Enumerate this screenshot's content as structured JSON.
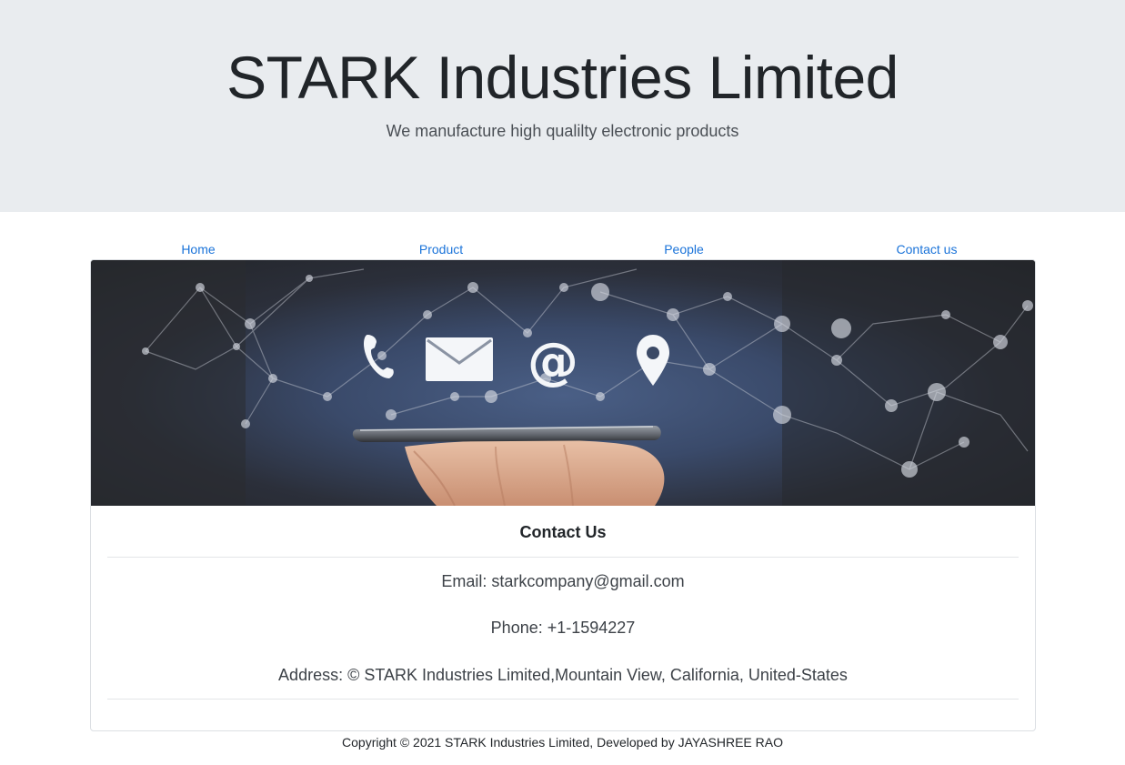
{
  "header": {
    "title": "STARK Industries Limited",
    "tagline": "We manufacture high qualilty electronic products"
  },
  "nav": {
    "items": [
      {
        "label": "Home"
      },
      {
        "label": "Product"
      },
      {
        "label": "People"
      },
      {
        "label": "Contact us"
      }
    ]
  },
  "hero": {
    "icons": [
      "phone-icon",
      "envelope-icon",
      "at-sign-icon",
      "location-pin-icon"
    ],
    "subject": "hand holding smartphone with network lines"
  },
  "contact": {
    "heading": "Contact Us",
    "email": "Email: starkcompany@gmail.com",
    "phone": "Phone: +1-1594227",
    "address": "Address: © STARK Industries Limited,Mountain View, California, United-States"
  },
  "footer": {
    "text": "Copyright © 2021 STARK Industries Limited, Developed by JAYASHREE RAO"
  },
  "colors": {
    "jumbotron_bg": "#e9ecef",
    "link": "#1a73d9",
    "text": "#212529"
  }
}
